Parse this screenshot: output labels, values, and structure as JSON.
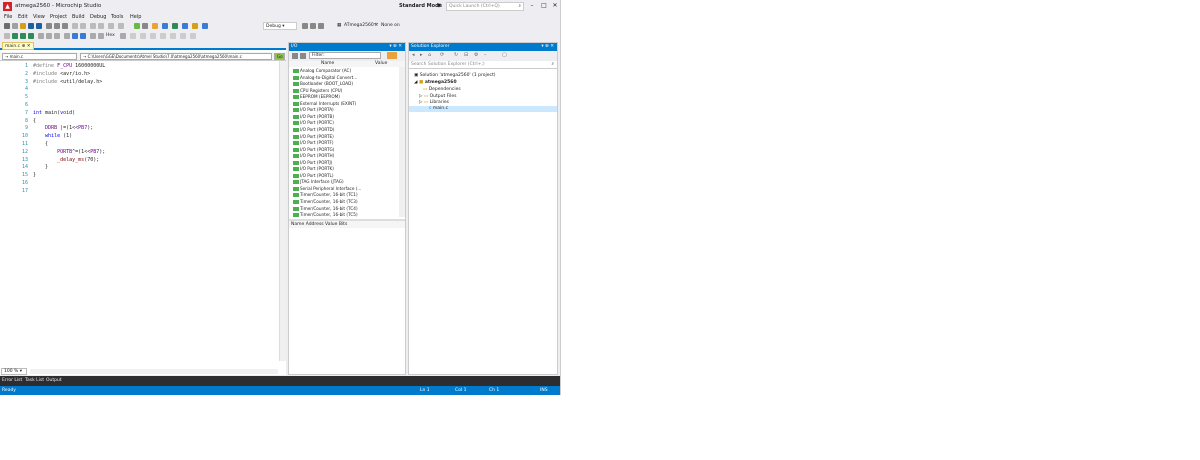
{
  "window": {
    "title": "atmega2560 - Microchip Studio",
    "mode": "Standard Mode",
    "search_placeholder": "Quick Launch (Ctrl+Q)"
  },
  "menu": [
    "File",
    "Edit",
    "View",
    "Project",
    "Build",
    "Debug",
    "Tools",
    "Help"
  ],
  "toolbar": {
    "config": "Debug",
    "device": "ATmega2560",
    "tool": "None on",
    "hex_label": "Hex"
  },
  "editor": {
    "tab": "main.c",
    "nav_scope": "main.c",
    "nav_path": "C:\\Users\\GGE\\Documents\\Atmel Studio\\7.0\\atmega2560\\atmega2560\\main.c",
    "zoom": "100 %",
    "lines": [
      {
        "n": "1",
        "tokens": [
          [
            "pp",
            "#define "
          ],
          [
            "mac",
            "F_CPU"
          ],
          [
            "",
            " 16000000UL"
          ]
        ]
      },
      {
        "n": "2",
        "tokens": [
          [
            "pp",
            "#include "
          ],
          [
            "",
            "<avr/io.h>"
          ]
        ]
      },
      {
        "n": "3",
        "tokens": [
          [
            "pp",
            "#include "
          ],
          [
            "",
            "<util/delay.h>"
          ]
        ]
      },
      {
        "n": "4",
        "tokens": []
      },
      {
        "n": "5",
        "tokens": []
      },
      {
        "n": "6",
        "tokens": []
      },
      {
        "n": "7",
        "tokens": [
          [
            "kw",
            "int "
          ],
          [
            "",
            "main("
          ],
          [
            "kw",
            "void"
          ],
          [
            "",
            ")"
          ]
        ]
      },
      {
        "n": "8",
        "tokens": [
          [
            "",
            "{"
          ]
        ]
      },
      {
        "n": "9",
        "tokens": [
          [
            "",
            "    "
          ],
          [
            "mac",
            "DDRB"
          ],
          [
            "",
            " |=(1<<"
          ],
          [
            "mac",
            "PB7"
          ],
          [
            "",
            ");"
          ]
        ]
      },
      {
        "n": "10",
        "tokens": [
          [
            "",
            "    "
          ],
          [
            "kw",
            "while"
          ],
          [
            "",
            " (1)"
          ]
        ]
      },
      {
        "n": "11",
        "tokens": [
          [
            "",
            "    {"
          ]
        ]
      },
      {
        "n": "12",
        "tokens": [
          [
            "",
            "        "
          ],
          [
            "mac",
            "PORTB"
          ],
          [
            "",
            "^=(1<<"
          ],
          [
            "mac",
            "PB7"
          ],
          [
            "",
            ");"
          ]
        ]
      },
      {
        "n": "13",
        "tokens": [
          [
            "",
            "        "
          ],
          [
            "fn",
            "_delay_ms"
          ],
          [
            "",
            "(70);"
          ]
        ]
      },
      {
        "n": "14",
        "tokens": [
          [
            "",
            "    }"
          ]
        ]
      },
      {
        "n": "15",
        "tokens": [
          [
            "",
            "}"
          ]
        ]
      },
      {
        "n": "16",
        "tokens": []
      },
      {
        "n": "17",
        "tokens": []
      }
    ]
  },
  "io_panel": {
    "title": "I/O",
    "filter": "Filter:",
    "col_name": "Name",
    "col_value": "Value",
    "bottom_cols": "Name  Address  Value  Bits",
    "rows": [
      "Analog Comparator (AC)",
      "Analog-to-Digital Convert...",
      "Bootloader (BOOT_LOAD)",
      "CPU Registers (CPU)",
      "EEPROM (EEPROM)",
      "External Interrupts (EXINT)",
      "I/O Port (PORTA)",
      "I/O Port (PORTB)",
      "I/O Port (PORTC)",
      "I/O Port (PORTD)",
      "I/O Port (PORTE)",
      "I/O Port (PORTF)",
      "I/O Port (PORTG)",
      "I/O Port (PORTH)",
      "I/O Port (PORTJ)",
      "I/O Port (PORTK)",
      "I/O Port (PORTL)",
      "JTAG Interface (JTAG)",
      "Serial Peripheral Interface (...",
      "Timer/Counter, 16-bit (TC1)",
      "Timer/Counter, 16-bit (TC3)",
      "Timer/Counter, 16-bit (TC4)",
      "Timer/Counter, 16-bit (TC5)"
    ]
  },
  "solution": {
    "title": "Solution Explorer",
    "search": "Search Solution Explorer (Ctrl+;)",
    "items": [
      "Solution 'atmega2560' (1 project)",
      "atmega2560",
      "Dependencies",
      "Output Files",
      "Libraries",
      "main.c"
    ]
  },
  "bottom_tabs": [
    "Error List",
    "Task List",
    "Output"
  ],
  "status": {
    "ready": "Ready",
    "ln": "Ln 1",
    "col": "Col 1",
    "ch": "Ch 1",
    "ins": "INS"
  }
}
